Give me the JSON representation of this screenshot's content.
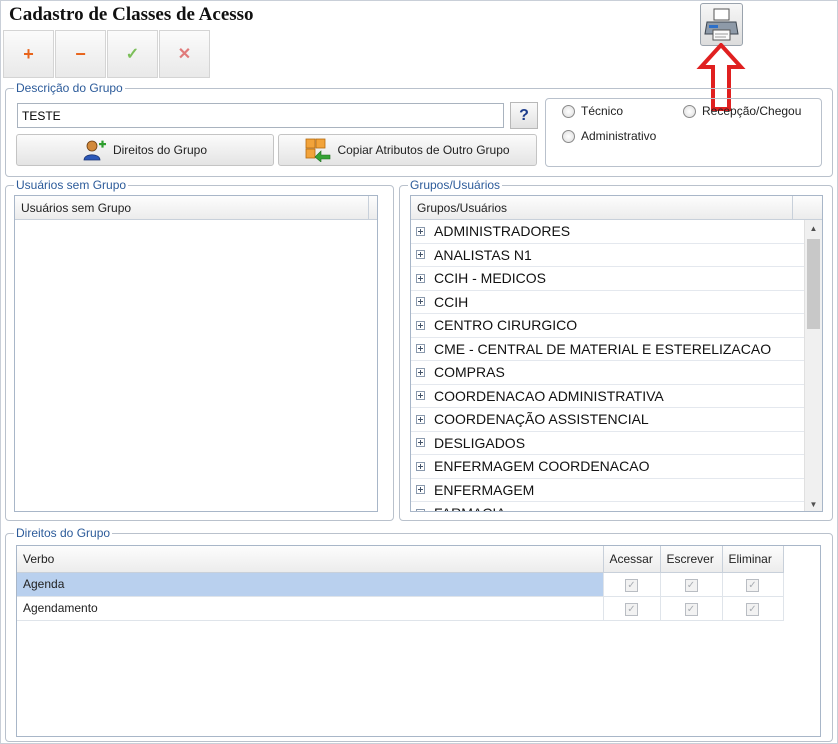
{
  "window": {
    "title": "Cadastro de Classes de Acesso"
  },
  "toolbar": {
    "add": "+",
    "remove": "−",
    "confirm": "✓",
    "cancel": "✕"
  },
  "descricao": {
    "legend": "Descrição do Grupo",
    "group_name": "TESTE",
    "help": "?",
    "direitos_button": "Direitos do Grupo",
    "copiar_button": "Copiar Atributos de Outro Grupo",
    "radios": {
      "tecnico": "Técnico",
      "recepcao": "Recepção/Chegou",
      "administrativo": "Administrativo"
    }
  },
  "usuarios_sem_grupo": {
    "legend": "Usuários sem Grupo",
    "column": "Usuários sem Grupo"
  },
  "grupos_usuarios": {
    "legend": "Grupos/Usuários",
    "column": "Grupos/Usuários",
    "items": [
      "ADMINISTRADORES",
      "ANALISTAS N1",
      "CCIH - MEDICOS",
      "CCIH",
      "CENTRO CIRURGICO",
      "CME - CENTRAL DE MATERIAL E ESTERELIZACAO",
      "COMPRAS",
      "COORDENACAO ADMINISTRATIVA",
      "COORDENAÇÃO ASSISTENCIAL",
      "DESLIGADOS",
      "ENFERMAGEM COORDENACAO",
      "ENFERMAGEM",
      "FARMACIA"
    ]
  },
  "direitos": {
    "legend": "Direitos do Grupo",
    "columns": {
      "verbo": "Verbo",
      "acessar": "Acessar",
      "escrever": "Escrever",
      "eliminar": "Eliminar"
    },
    "rows": [
      {
        "verbo": "Agenda",
        "acessar": true,
        "escrever": true,
        "eliminar": true
      },
      {
        "verbo": "Agendamento",
        "acessar": true,
        "escrever": true,
        "eliminar": true
      }
    ]
  },
  "colors": {
    "legend": "#2c5b9a",
    "selection": "#b9d0ee",
    "annotation_arrow": "#e02020",
    "add_remove": "#e8641b"
  }
}
